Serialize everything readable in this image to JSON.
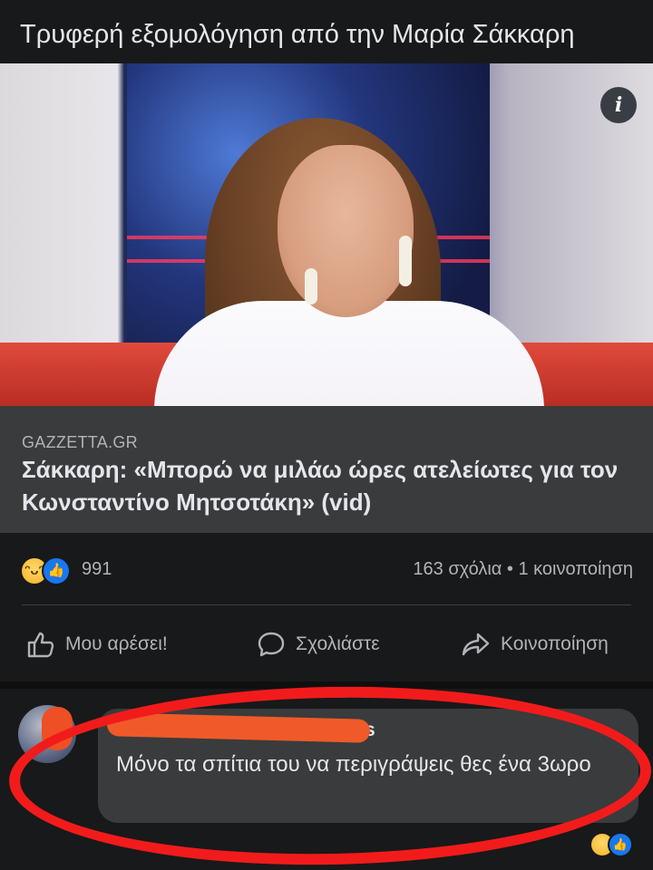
{
  "post": {
    "text": "Τρυφερή εξομολόγηση από την Μαρία Σάκκαρη"
  },
  "video": {
    "info_icon": "info-icon"
  },
  "link": {
    "source": "GAZZETTA.GR",
    "headline": "Σάκκαρη: «Μπορώ να μιλάω ώρες ατελείωτες για τον Κωνσταντίνο Μητσοτάκη» (vid)"
  },
  "stats": {
    "reaction_icons": [
      "haha-icon",
      "like-icon"
    ],
    "reaction_count": "991",
    "comments_shares": "163 σχόλια • 1 κοινοποίηση"
  },
  "actions": {
    "like_label": "Μου αρέσει!",
    "comment_label": "Σχολιάστε",
    "share_label": "Κοινοποίηση"
  },
  "comment": {
    "author_visible": "s",
    "text": "Μόνο τα σπίτια του να περιγράψεις θες ένα 3ωρο"
  },
  "colors": {
    "background": "#18191a",
    "card": "#3a3b3c",
    "annotation_red": "#f21b1b",
    "like_blue": "#1877f2"
  }
}
